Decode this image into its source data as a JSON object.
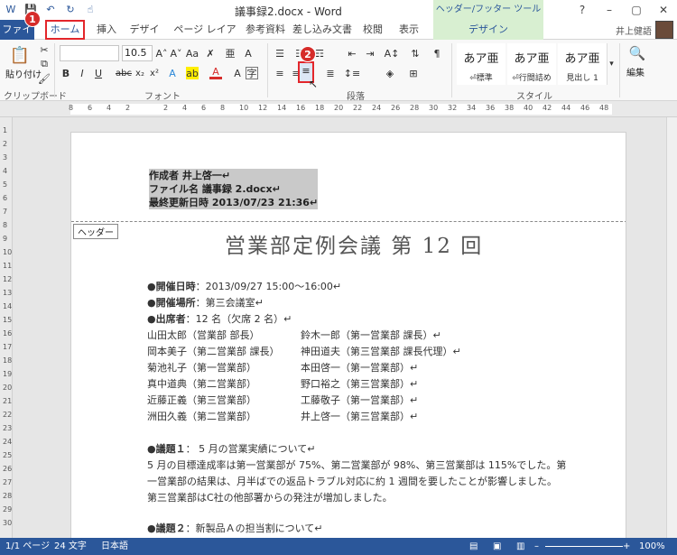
{
  "titlebar": {
    "title": "議事録2.docx - Word",
    "context_tool": "ヘッダー/フッター ツール",
    "help": "?",
    "minimize": "–",
    "restore": "▢",
    "close": "✕"
  },
  "tabs": {
    "file": "ファイル",
    "home": "ホーム",
    "insert": "挿入",
    "design": "デザイン",
    "layout": "ページ レイアウト",
    "references": "参考資料",
    "mailings": "差し込み文書",
    "review": "校閲",
    "view": "表示",
    "hf_design": "デザイン"
  },
  "user": {
    "name": "井上健語"
  },
  "ribbon": {
    "paste_label": "貼り付け",
    "clipboard_label": "クリップボード",
    "font_label": "フォント",
    "paragraph_label": "段落",
    "styles_label": "スタイル",
    "editing_label": "編集",
    "font_size": "10.5",
    "styles": [
      {
        "preview": "あア亜",
        "name": "⏎標準"
      },
      {
        "preview": "あア亜",
        "name": "⏎行間詰め"
      },
      {
        "preview": "あア亜",
        "name": "見出し 1"
      }
    ]
  },
  "badges": {
    "one": "1",
    "two": "2"
  },
  "ruler_numbers": [
    "8",
    "6",
    "4",
    "2",
    "",
    "2",
    "4",
    "6",
    "8",
    "10",
    "12",
    "14",
    "16",
    "18",
    "20",
    "22",
    "24",
    "26",
    "28",
    "30",
    "32",
    "34",
    "36",
    "38",
    "40",
    "42",
    "44",
    "46",
    "48"
  ],
  "vruler_numbers": [
    "1",
    "2",
    "3",
    "4",
    "5",
    "6",
    "7",
    "8",
    "9",
    "10",
    "11",
    "12",
    "13",
    "14",
    "15",
    "16",
    "17",
    "18",
    "19",
    "20",
    "21",
    "22",
    "23",
    "24",
    "25",
    "26",
    "27",
    "28",
    "29",
    "30"
  ],
  "header": {
    "author_label": "作成者",
    "author": "井上啓一",
    "file_label": "ファイル名",
    "file": "議事録 2.docx",
    "modified_label": "最終更新日時",
    "modified": "2013/07/23 21:36",
    "tag": "ヘッダー"
  },
  "body": {
    "title": "営業部定例会議 第 12 回",
    "date_label": "●開催日時",
    "date": "：2013/09/27 15:00〜16:00",
    "place_label": "●開催場所",
    "place": "：第三会議室",
    "attend_label": "●出席者",
    "attend": "：12 名（欠席 2 名）",
    "attendees_left": [
      "山田太郎（営業部 部長）",
      "岡本美子（第二営業部 課長）",
      "菊池礼子（第一営業部）",
      "真中道典（第二営業部）",
      "近藤正義（第三営業部）",
      "洲田久義（第二営業部）"
    ],
    "attendees_right": [
      "鈴木一郎（第一営業部 課長）",
      "神田道夫（第三営業部 課長代理）",
      "本田啓一（第一営業部）",
      "野口裕之（第三営業部）",
      "工藤敬子（第一営業部）",
      "井上啓一（第三営業部）"
    ],
    "topic1_label": "●議題１",
    "topic1": "： 5 月の営業実績について",
    "para1": "5 月の目標達成率は第一営業部が 75%、第二営業部が 98%、第三営業部は 115%でした。第",
    "para2": "一営業部の結果は、月半ばでの返品トラブル対応に約 1 週間を要したことが影響しました。",
    "para3": "第三営業部はC社の他部署からの発注が増加しました。",
    "topic2_label": "●議題２",
    "topic2": "：新製品Ａの担当割について"
  },
  "status": {
    "page": "1/1 ページ",
    "words": "24 文字",
    "lang": "日本語",
    "zoom": "100%"
  },
  "colors": {
    "accent": "#2b579a",
    "badge": "#d62c2a"
  }
}
